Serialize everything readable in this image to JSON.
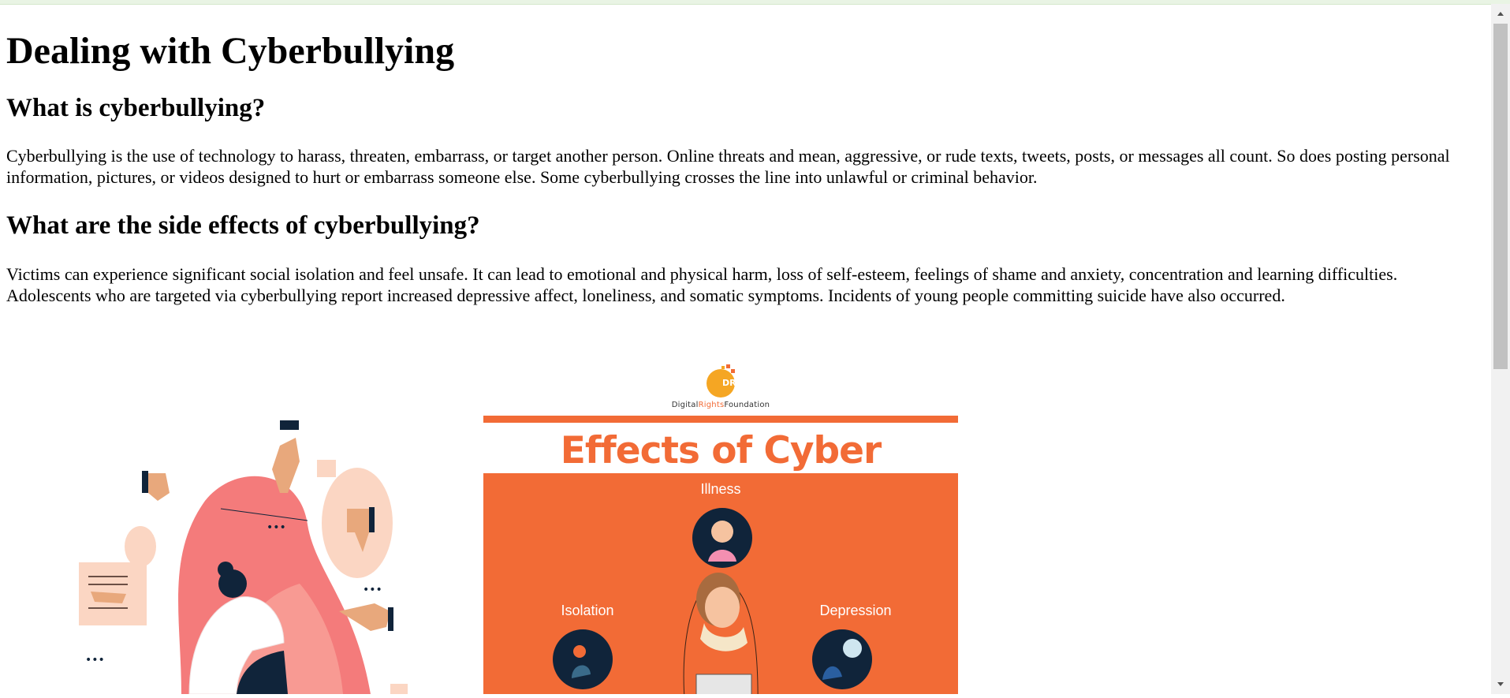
{
  "article": {
    "title": "Dealing with Cyberbullying",
    "section1_heading": "What is cyberbullying?",
    "section1_text": "Cyberbullying is the use of technology to harass, threaten, embarrass, or target another person. Online threats and mean, aggressive, or rude texts, tweets, posts, or messages all count. So does posting personal information, pictures, or videos designed to hurt or embarrass someone else. Some cyberbullying crosses the line into unlawful or criminal behavior.",
    "section2_heading": "What are the side effects of cyberbullying?",
    "section2_text": "Victims can experience significant social isolation and feel unsafe. It can lead to emotional and physical harm, loss of self-esteem, feelings of shame and anxiety, concentration and learning difficulties. Adolescents who are targeted via cyberbullying report increased depressive affect, loneliness, and somatic symptoms. Incidents of young people committing suicide have also occurred."
  },
  "infographic": {
    "logo_badge": "DRF",
    "org_part1": "Digital",
    "org_part2": "Rights",
    "org_part3": "Foundation",
    "title": "Effects of Cyber bullying",
    "labels": {
      "illness": "Illness",
      "isolation": "Isolation",
      "depression": "Depression"
    }
  },
  "colors": {
    "accent": "#f26b36",
    "illustration_pink": "#f47b7b",
    "illustration_skin": "#f6c3a0",
    "illustration_navy": "#10243a"
  },
  "icons": [
    "thumbs-down-icon",
    "pointing-hand-icon",
    "speech-bubble-icon",
    "ellipsis-icon"
  ]
}
